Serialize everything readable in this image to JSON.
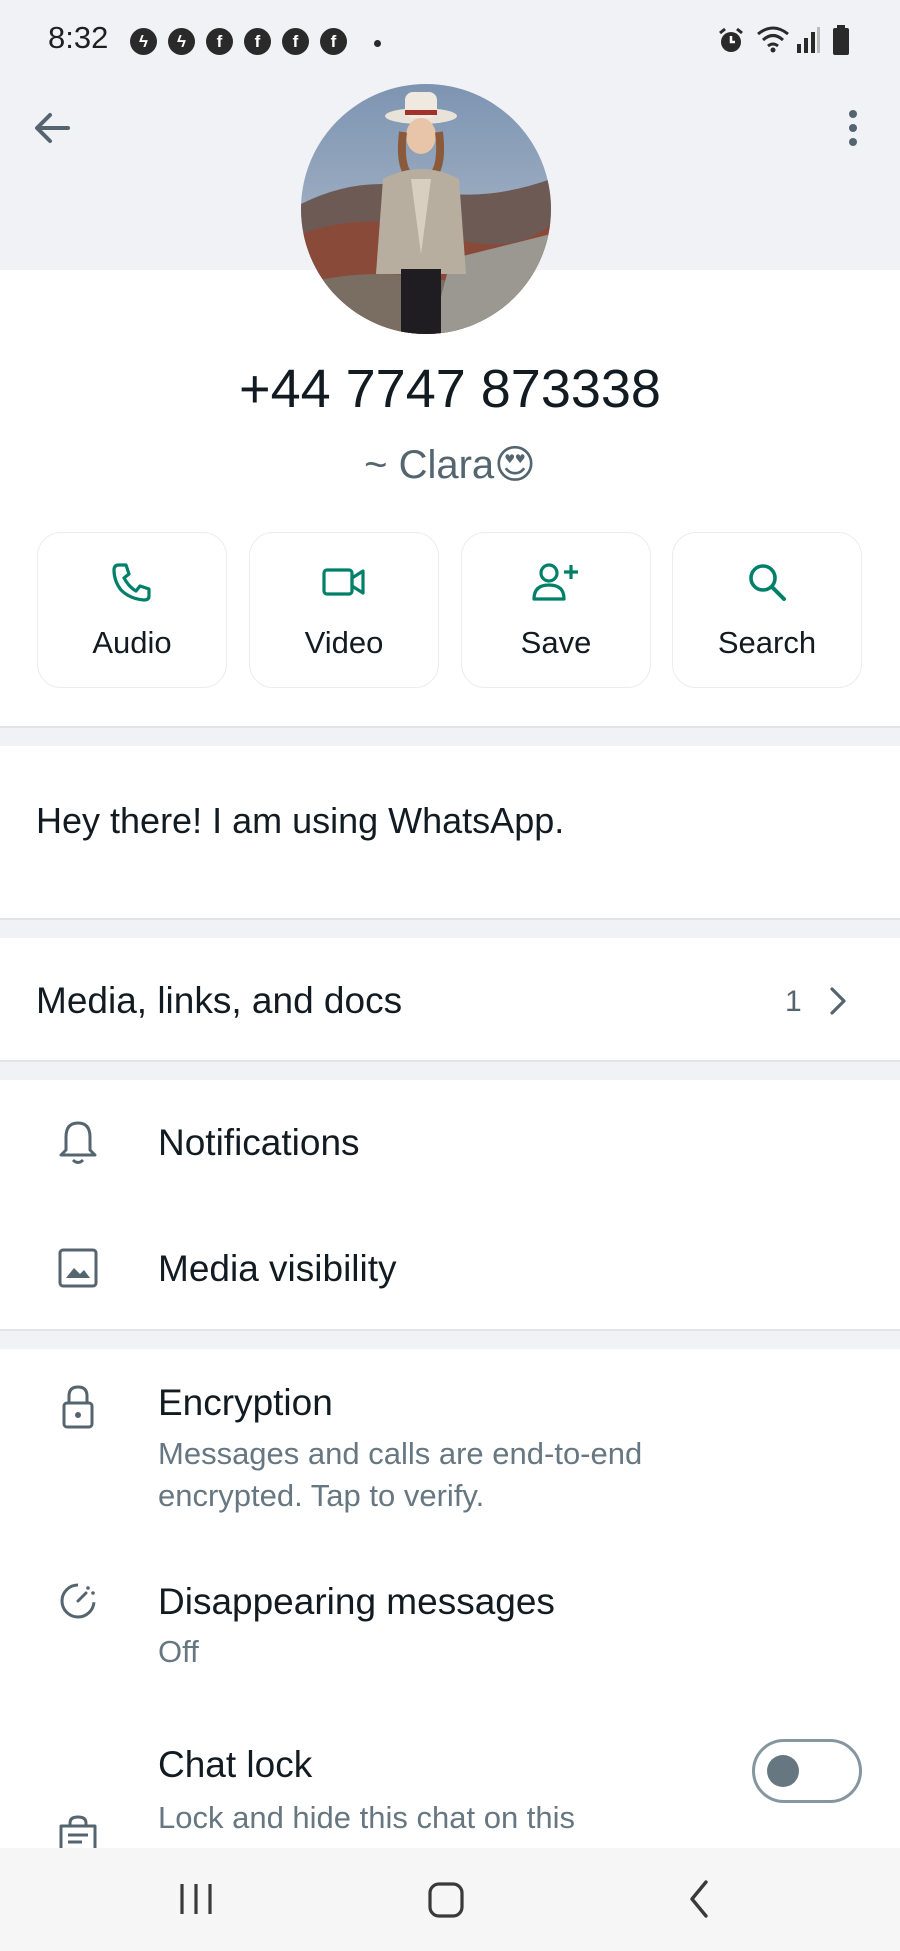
{
  "status_bar": {
    "time": "8:32",
    "notification_icons": [
      "messenger-icon",
      "messenger-icon",
      "facebook-icon",
      "facebook-icon",
      "facebook-icon",
      "facebook-icon"
    ],
    "right_icons": [
      "alarm-icon",
      "wifi-icon",
      "signal-icon",
      "battery-icon"
    ]
  },
  "header": {
    "back_icon": "arrow-left-icon",
    "menu_icon": "more-vertical-icon"
  },
  "contact": {
    "number": "+44 7747 873338",
    "name": "~ Clara😍"
  },
  "actions": [
    {
      "label": "Audio",
      "icon": "phone-icon"
    },
    {
      "label": "Video",
      "icon": "video-camera-icon"
    },
    {
      "label": "Save",
      "icon": "add-person-icon"
    },
    {
      "label": "Search",
      "icon": "search-icon"
    }
  ],
  "about": "Hey there! I am using WhatsApp.",
  "media": {
    "label": "Media, links, and docs",
    "count": "1"
  },
  "settings": [
    {
      "title": "Notifications",
      "icon": "bell-icon"
    },
    {
      "title": "Media visibility",
      "icon": "image-icon"
    }
  ],
  "privacy": [
    {
      "title": "Encryption",
      "subtitle": "Messages and calls are end-to-end encrypted. Tap to verify.",
      "icon": "lock-icon"
    },
    {
      "title": "Disappearing messages",
      "subtitle": "Off",
      "icon": "timer-icon"
    },
    {
      "title": "Chat lock",
      "subtitle": "Lock and hide this chat on this",
      "icon": "chat-lock-icon",
      "toggle": "off"
    }
  ],
  "colors": {
    "accent": "#008069",
    "background": "#ffffff",
    "section_gap": "#f0f2f5",
    "secondary_text": "#667781"
  }
}
